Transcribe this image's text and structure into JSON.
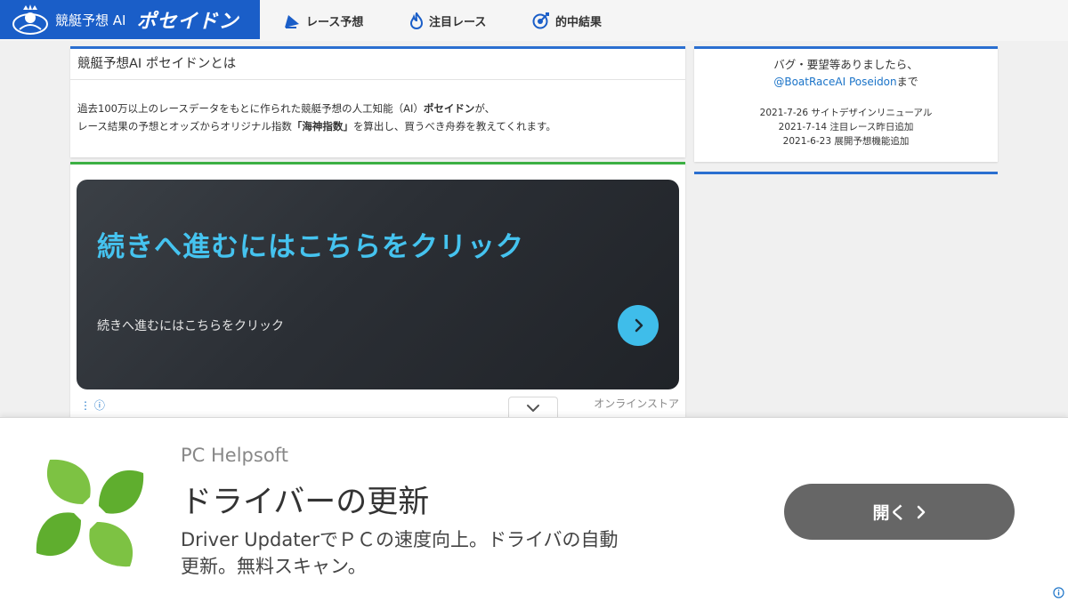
{
  "header": {
    "logo_text": "競艇予想 AI",
    "logo_brand": "ポセイドン",
    "nav": [
      {
        "label": "レース予想",
        "icon": "flag-icon"
      },
      {
        "label": "注目レース",
        "icon": "fire-icon"
      },
      {
        "label": "的中結果",
        "icon": "target-icon"
      }
    ]
  },
  "about": {
    "title": "競艇予想AI ポセイドンとは",
    "line1_prefix": "過去100万以上のレースデータをもとに作られた競艇予想の人工知能（AI）",
    "line1_bold": "ポセイドン",
    "line1_suffix": "が、",
    "line2_prefix": "レース結果の予想とオッズからオリジナル指数",
    "line2_bold": "「海神指数」",
    "line2_suffix": "を算出し、買うべき舟券を教えてくれます。"
  },
  "side": {
    "message": "バグ・要望等ありましたら、",
    "link": "@BoatRaceAI Poseidon",
    "link_suffix": "まで",
    "updates": [
      "2021-7-26 サイトデザインリニューアル",
      "2021-7-14 注目レース昨日追加",
      "2021-6-23 展開予想機能追加"
    ]
  },
  "ad_card": {
    "headline": "続きへ進むにはこちらをクリック",
    "subtext": "続きへ進むにはこちらをクリック",
    "dots": "⋮ ⓘ",
    "store": "オンラインストア"
  },
  "banner": {
    "advertiser": "PC Helpsoft",
    "title": "ドライバーの更新",
    "desc_line1": "Driver UpdaterでＰＣの速度向上。ドライバの自動",
    "desc_line2": "更新。無料スキャン。",
    "button_label": "開く"
  },
  "colors": {
    "brand_blue": "#1a5ec8",
    "accent_cyan": "#45c3ef",
    "green_rule": "#3cb043"
  }
}
